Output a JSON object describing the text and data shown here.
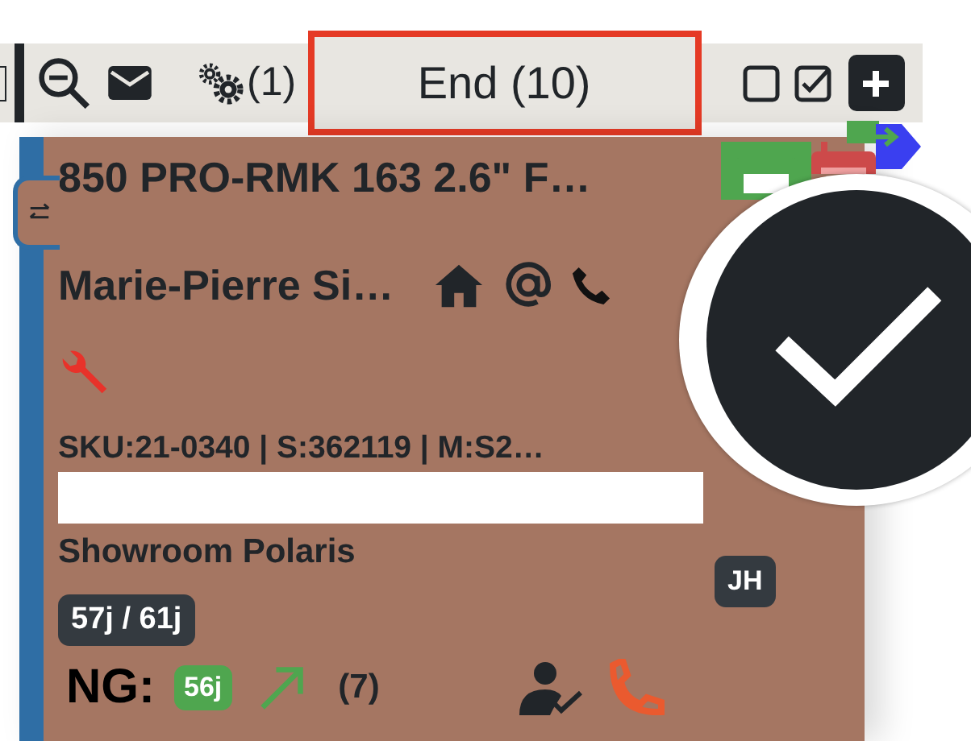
{
  "toolbar": {
    "filter_count": "(1)",
    "end_button": {
      "label": "End (10)",
      "highlighted": true
    }
  },
  "card": {
    "title": "850 PRO-RMK 163 2.6\" F…",
    "customer": "Marie-Pierre Si…",
    "sku_line": "SKU:21-0340 | S:362119 | M:S2…",
    "location": "Showroom Polaris",
    "assignee": "JH",
    "duration": "57j / 61j",
    "ng_label": "NG:",
    "ng_days": "56j",
    "count": "(7)",
    "done": true
  }
}
